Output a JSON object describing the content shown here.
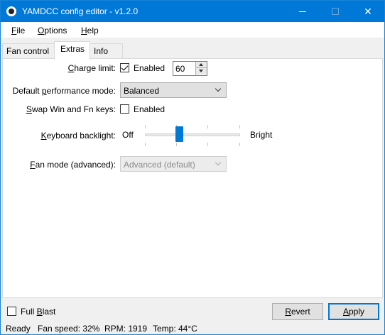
{
  "window": {
    "title": "YAMDCC config editor - v1.2.0"
  },
  "menu": [
    {
      "pre": "",
      "ul": "F",
      "post": "ile"
    },
    {
      "pre": "",
      "ul": "O",
      "post": "ptions"
    },
    {
      "pre": "",
      "ul": "H",
      "post": "elp"
    }
  ],
  "tabs": [
    "Fan control",
    "Extras",
    "Info"
  ],
  "active_tab": "Extras",
  "extras": {
    "charge_limit": {
      "label_ul": "C",
      "label_post": "harge limit:",
      "checkbox_label": "Enabled",
      "checked": true,
      "value": "60"
    },
    "perf_mode": {
      "label_pre": "Default ",
      "label_ul": "p",
      "label_post": "erformance mode:",
      "selected": "Balanced"
    },
    "swap_keys": {
      "label_ul": "S",
      "label_post": "wap Win and Fn keys:",
      "checkbox_label": "Enabled",
      "checked": false
    },
    "backlight": {
      "label_ul": "K",
      "label_post": "eyboard backlight:",
      "min_label": "Off",
      "max_label": "Bright",
      "level": 0.35
    },
    "fan_mode": {
      "label_ul": "F",
      "label_post": "an mode (advanced):",
      "selected": "Advanced (default)",
      "enabled": false
    }
  },
  "bottom": {
    "full_blast": {
      "pre": "Full ",
      "ul": "B",
      "post": "last",
      "checked": false
    },
    "revert": {
      "ul": "R",
      "post": "evert"
    },
    "apply": {
      "ul": "A",
      "post": "pply"
    }
  },
  "status": {
    "state": "Ready",
    "fan_speed": "Fan speed: 32%",
    "rpm": "RPM: 1919",
    "temp": "Temp: 44°C"
  }
}
